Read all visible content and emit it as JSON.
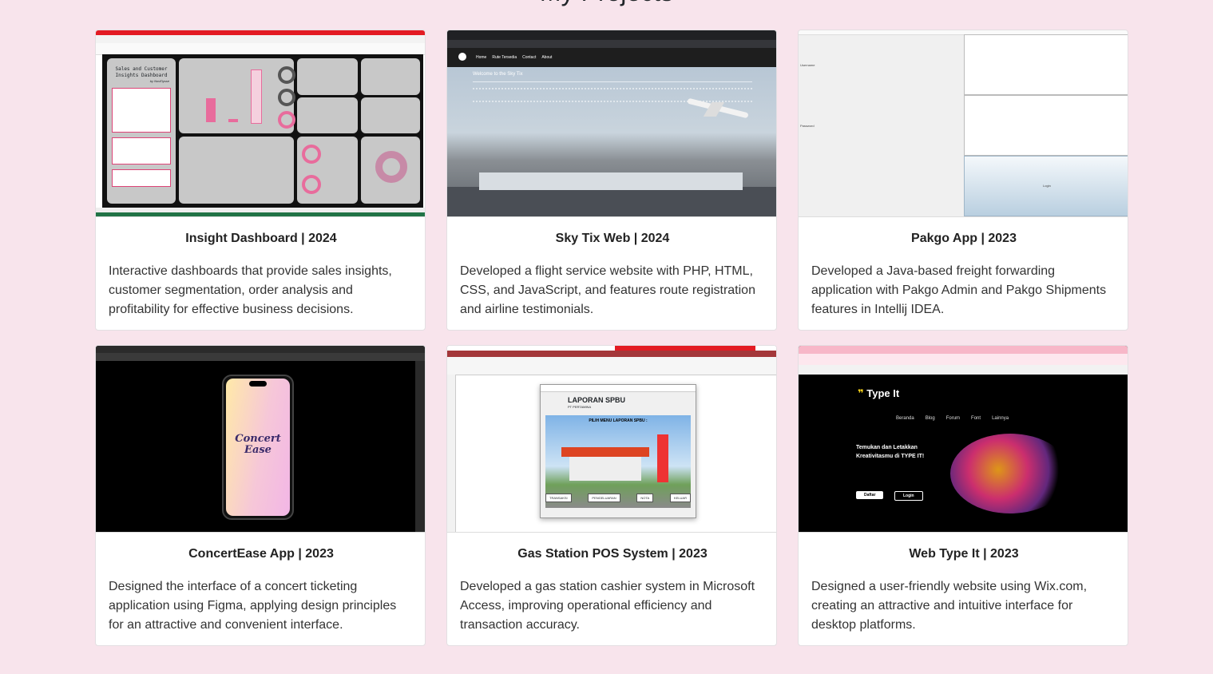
{
  "section": {
    "title": "My Projects"
  },
  "projects": [
    {
      "title": "Insight Dashboard | 2024",
      "description": "Interactive dashboards that provide sales insights, customer segmentation, order analysis and profitability for effective business decisions.",
      "thumb": {
        "heading": "Sales and Customer Insights Dashboard",
        "byline": "by NovElysse"
      }
    },
    {
      "title": "Sky Tix Web | 2024",
      "description": "Developed a flight service website with PHP, HTML, CSS, and JavaScript, and features route registration and airline testimonials.",
      "thumb": {
        "nav": [
          "Home",
          "Rute Tersedia",
          "Contact",
          "About"
        ],
        "welcome": "Welcome to the Sky Tix"
      }
    },
    {
      "title": "Pakgo App | 2023",
      "description": "Developed a Java-based freight forwarding application with Pakgo Admin and Pakgo Shipments features in Intellij IDEA.",
      "thumb": {
        "username": "Username",
        "password": "Password",
        "login": "Login"
      }
    },
    {
      "title": "ConcertEase App | 2023",
      "description": "Designed the interface of a concert ticketing application using Figma, applying design principles for an attractive and convenient interface.",
      "thumb": {
        "logo_line1": "Concert",
        "logo_line2": "Ease"
      }
    },
    {
      "title": "Gas Station POS System | 2023",
      "description": "Developed a gas station cashier system in Microsoft Access, improving operational efficiency and transaction accuracy.",
      "thumb": {
        "form_title": "LAPORAN SPBU",
        "company": "PT PERTAMINA",
        "menu": "PILIH MENU LAPORAN SPBU :",
        "buttons": [
          "TRANSAKSI",
          "PENGELUARAN",
          "NOTA",
          "KELUAR"
        ]
      }
    },
    {
      "title": "Web Type It | 2023",
      "description": "Designed a user-friendly website using Wix.com, creating an attractive and intuitive interface for desktop platforms.",
      "thumb": {
        "brand": "Type It",
        "nav": [
          "Beranda",
          "Blog",
          "Forum",
          "Font",
          "Lainnya"
        ],
        "hero": "Temukan dan Letakkan Kreativitasmu di TYPE IT!",
        "daftar": "Daftar",
        "login": "Login"
      }
    }
  ]
}
